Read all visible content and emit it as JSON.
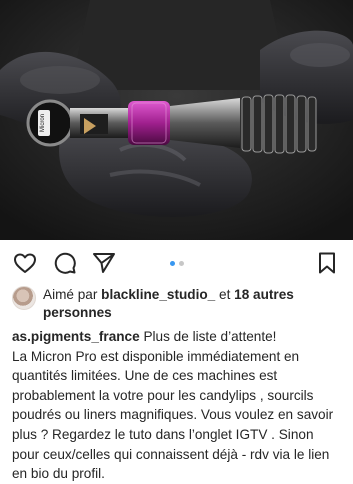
{
  "post": {
    "image_alt": "Tattoo machine held in black-gloved hands",
    "machine_label": "Micron"
  },
  "actions": {
    "like_icon": "heart-icon",
    "comment_icon": "comment-icon",
    "share_icon": "paper-plane-icon",
    "save_icon": "bookmark-icon",
    "carousel_count": 2,
    "carousel_active": 1
  },
  "likes": {
    "prefix": "Aimé par ",
    "user": "blackline_studio_",
    "connector": " et ",
    "others": "18 autres personnes"
  },
  "caption": {
    "username": "as.pigments_france",
    "text": " Plus de liste d’attente!\nLa Micron Pro est disponible immédiatement en quantités limitées. Une de ces machines est probablement la votre pour les candylips , sourcils poudrés ou liners magnifiques. Vous voulez en savoir plus ? Regardez le tuto dans l’onglet IGTV . Sinon pour ceux/celles qui connaissent déjà - rdv via le lien en bio du profil."
  },
  "colors": {
    "accent": "#3897f0",
    "text": "#262626",
    "machine_accent": "#a0208e"
  }
}
